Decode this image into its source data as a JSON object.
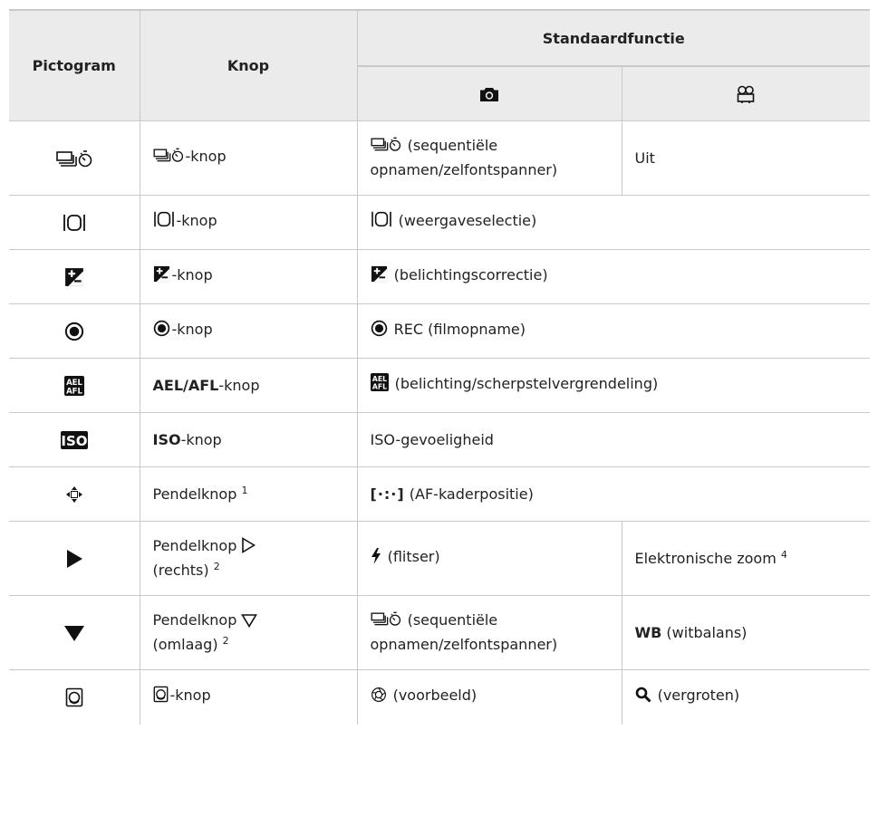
{
  "header": {
    "pictogram": "Pictogram",
    "knop": "Knop",
    "standaardfunctie": "Standaardfunctie",
    "photo_mode_icon": "camera-icon",
    "movie_mode_icon": "movie-camera-icon"
  },
  "rows": [
    {
      "icon": "sequential-self-timer-icon",
      "knop_suffix": "-knop",
      "photo_text": " (sequentiële opnamen/zelfontspanner)",
      "movie_text": "Uit"
    },
    {
      "icon": "display-selection-icon",
      "knop_suffix": "-knop",
      "func_text": " (weergaveselectie)"
    },
    {
      "icon": "exposure-compensation-icon",
      "knop_suffix": "-knop",
      "func_text": " (belichtingscorrectie)"
    },
    {
      "icon": "rec-icon",
      "knop_suffix": "-knop",
      "func_text": " REC (filmopname)"
    },
    {
      "icon": "ael-afl-icon",
      "knop_bold": "AEL/AFL",
      "knop_suffix": "-knop",
      "func_text": " (belichting/scherpstelvergrendeling)"
    },
    {
      "icon": "iso-icon",
      "knop_bold": "ISO",
      "knop_suffix": "-knop",
      "func_text": "ISO-gevoeligheid"
    },
    {
      "icon": "arrow-pad-icon",
      "knop_text": "Pendelknop",
      "knop_sup": "1",
      "func_prefix": "[·:·]",
      "func_text": " (AF-kaderpositie)"
    },
    {
      "icon": "triangle-right-icon",
      "knop_text": "Pendelknop",
      "knop_line2": "(rechts)",
      "knop_sup": "2",
      "photo_glyph": "flash-icon",
      "photo_text": " (flitser)",
      "movie_text": "Elektronische zoom",
      "movie_sup": "4"
    },
    {
      "icon": "triangle-down-icon",
      "knop_text": "Pendelknop",
      "knop_line2": "(omlaag)",
      "knop_sup": "2",
      "photo_text": " (sequentiële opnamen/zelfontspanner)",
      "movie_bold": "WB",
      "movie_text": " (witbalans)"
    },
    {
      "icon": "preview-button-icon",
      "knop_suffix": "-knop",
      "photo_glyph": "preview-icon",
      "photo_text": " (voorbeeld)",
      "movie_glyph": "magnifier-icon",
      "movie_text": " (vergroten)"
    }
  ]
}
